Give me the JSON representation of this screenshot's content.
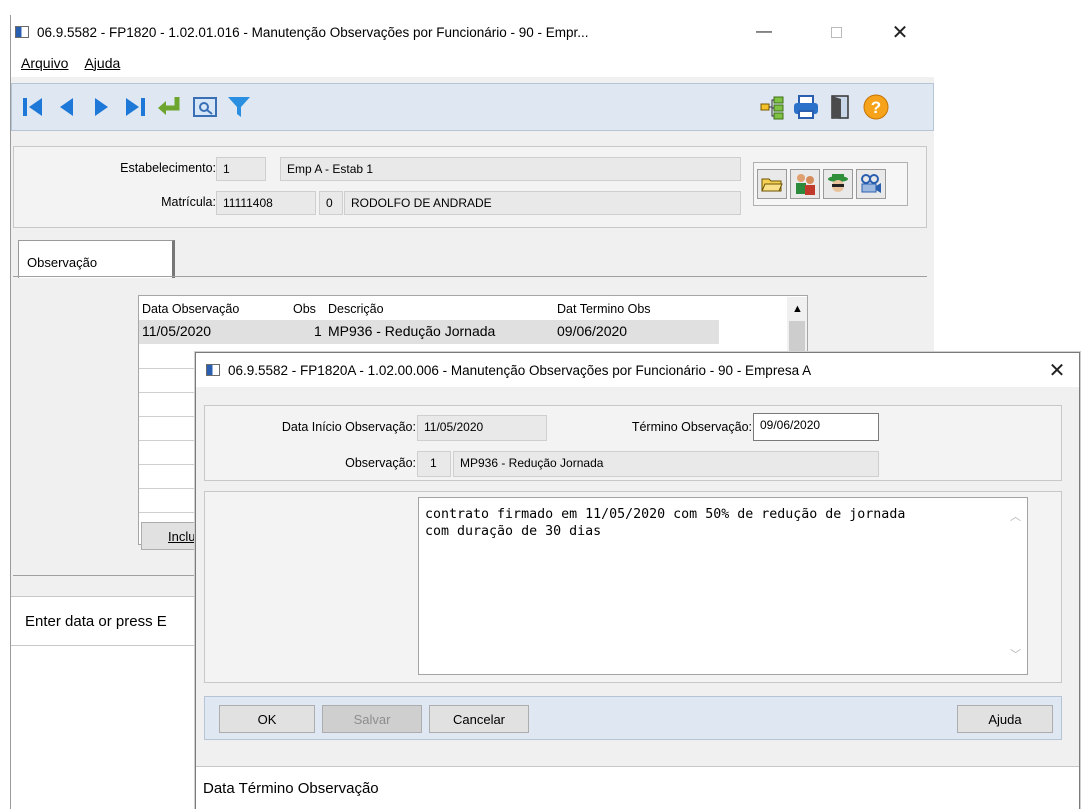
{
  "main_window": {
    "title": "06.9.5582 - FP1820 - 1.02.01.016 - Manutenção Observações por Funcionário - 90 - Empr...",
    "menu": [
      "Arquivo",
      "Ajuda"
    ],
    "estabelecimento_label": "Estabelecimento:",
    "estabelecimento_code": "1",
    "estabelecimento_name": "Emp A - Estab 1",
    "matricula_label": "Matrícula:",
    "matricula_value": "11111408",
    "matricula_digit": "0",
    "matricula_name": "RODOLFO DE ANDRADE",
    "tab_label": "Observação",
    "grid": {
      "headers": [
        "Data Observação",
        "Obs",
        "Descrição",
        "Dat Termino Obs"
      ],
      "rows": [
        {
          "data": "11/05/2020",
          "obs": "1",
          "descricao": "MP936 - Redução Jornada",
          "termino": "09/06/2020"
        }
      ]
    },
    "include_button": "Inclu",
    "status_text": "Enter data or press E"
  },
  "dialog": {
    "title": "06.9.5582 - FP1820A - 1.02.00.006 - Manutenção Observações por Funcionário - 90 - Empresa A",
    "data_inicio_label": "Data Início Observação:",
    "data_inicio_value": "11/05/2020",
    "termino_label": "Término Observação:",
    "termino_value": "09/06/2020",
    "observacao_label": "Observação:",
    "observacao_code": "1",
    "observacao_desc": "MP936 - Redução Jornada",
    "text_line1": "contrato firmado em 11/05/2020 com 50% de redução de jornada",
    "text_line2": "com duração de 30 dias",
    "buttons": {
      "ok": "OK",
      "salvar": "Salvar",
      "cancelar": "Cancelar",
      "ajuda": "Ajuda"
    },
    "status_text": "Data Término Observação"
  },
  "colors": {
    "toolbar_bg": "#dfe7f2",
    "nav_blue": "#1e78d7",
    "accent_green": "#7aa833"
  }
}
